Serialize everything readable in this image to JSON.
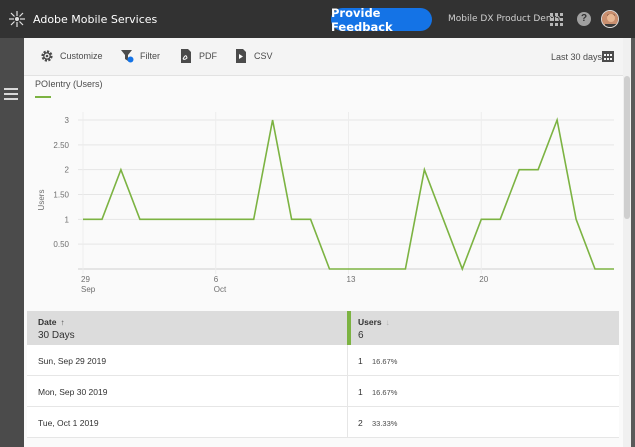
{
  "app": {
    "title": "Adobe Mobile Services"
  },
  "header": {
    "feedback_label": "Provide Feedback",
    "org_name": "Mobile DX Product Demo",
    "help_glyph": "?"
  },
  "toolbar": {
    "customize_label": "Customize",
    "filter_label": "Filter",
    "pdf_label": "PDF",
    "csv_label": "CSV",
    "date_range": "Last 30 days"
  },
  "legend": {
    "label": "POIentry (Users)",
    "color": "#7cb342"
  },
  "chart_data": {
    "type": "line",
    "title": "",
    "ylabel": "Users",
    "ylim": [
      0,
      3
    ],
    "yticks": [
      "0.50",
      "1",
      "1.50",
      "2",
      "2.50",
      "3"
    ],
    "xticks": [
      {
        "day": "29",
        "month": "Sep"
      },
      {
        "day": "6",
        "month": "Oct"
      },
      {
        "day": "13",
        "month": ""
      },
      {
        "day": "20",
        "month": ""
      }
    ],
    "series": [
      {
        "values": [
          1,
          1,
          2,
          1,
          1,
          1,
          1,
          1,
          1,
          1,
          3,
          1,
          1,
          0,
          0,
          0,
          0,
          0,
          2,
          1,
          0,
          1,
          1,
          2,
          2,
          3,
          1,
          0,
          0
        ]
      }
    ],
    "color": "#7cb342"
  },
  "table": {
    "col_date": "Date",
    "col_date_sub": "30 Days",
    "col_users": "Users",
    "col_users_sub": "6",
    "sort_up": "↑",
    "sort_down": "↓",
    "rows": [
      {
        "date": "Sun, Sep 29 2019",
        "users": "1",
        "pct": "16.67%"
      },
      {
        "date": "Mon, Sep 30 2019",
        "users": "1",
        "pct": "16.67%"
      },
      {
        "date": "Tue, Oct 1 2019",
        "users": "2",
        "pct": "33.33%"
      }
    ]
  }
}
